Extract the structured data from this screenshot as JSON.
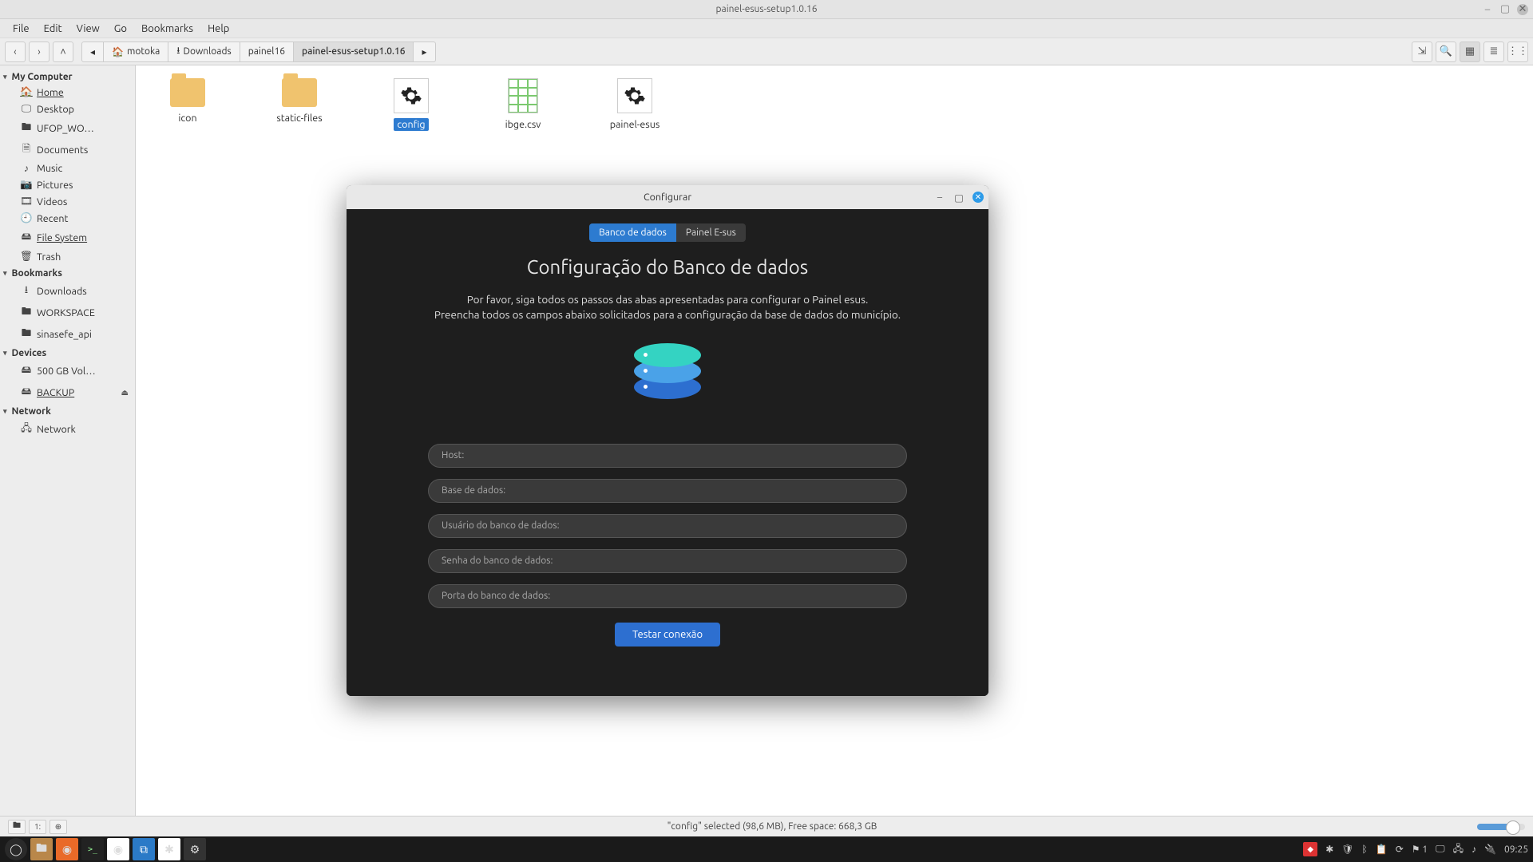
{
  "window": {
    "title": "painel-esus-setup1.0.16"
  },
  "menubar": [
    "File",
    "Edit",
    "View",
    "Go",
    "Bookmarks",
    "Help"
  ],
  "crumbs": [
    {
      "label": "motoka",
      "icon": "home"
    },
    {
      "label": "Downloads",
      "icon": "down"
    },
    {
      "label": "painel16"
    },
    {
      "label": "painel-esus-setup1.0.16",
      "active": true
    }
  ],
  "sidebar": {
    "my_computer": {
      "title": "My Computer",
      "items": [
        {
          "label": "Home",
          "icon": "home",
          "selected": true
        },
        {
          "label": "Desktop",
          "icon": "desktop"
        },
        {
          "label": "UFOP_WO…",
          "icon": "folder"
        },
        {
          "label": "Documents",
          "icon": "doc"
        },
        {
          "label": "Music",
          "icon": "music"
        },
        {
          "label": "Pictures",
          "icon": "pic"
        },
        {
          "label": "Videos",
          "icon": "vid"
        },
        {
          "label": "Recent",
          "icon": "clock"
        },
        {
          "label": "File System",
          "icon": "disk",
          "underline": true
        },
        {
          "label": "Trash",
          "icon": "trash"
        }
      ]
    },
    "bookmarks": {
      "title": "Bookmarks",
      "items": [
        {
          "label": "Downloads",
          "icon": "down"
        },
        {
          "label": "WORKSPACE",
          "icon": "folder"
        },
        {
          "label": "sinasefe_api",
          "icon": "folder"
        }
      ]
    },
    "devices": {
      "title": "Devices",
      "items": [
        {
          "label": "500 GB Vol…",
          "icon": "disk"
        },
        {
          "label": "BACKUP",
          "icon": "disk",
          "eject": true,
          "underline": true
        }
      ]
    },
    "network": {
      "title": "Network",
      "items": [
        {
          "label": "Network",
          "icon": "net"
        }
      ]
    }
  },
  "files": [
    {
      "name": "icon",
      "type": "folder"
    },
    {
      "name": "static-files",
      "type": "folder"
    },
    {
      "name": "config",
      "type": "exe",
      "selected": true
    },
    {
      "name": "ibge.csv",
      "type": "csv"
    },
    {
      "name": "painel-esus",
      "type": "exe"
    }
  ],
  "statusbar": {
    "text": "\"config\" selected (98,6 MB), Free space: 668,3 GB"
  },
  "dialog": {
    "title": "Configurar",
    "tabs": [
      {
        "label": "Banco de dados",
        "active": true
      },
      {
        "label": "Painel E-sus"
      }
    ],
    "heading": "Configuração do Banco de dados",
    "line1": "Por favor, siga todos os passos das abas apresentadas para configurar o Painel esus.",
    "line2": "Preencha todos os campos abaixo solicitados para a configuração da base de dados do município.",
    "fields": {
      "host": "Host:",
      "db": "Base de dados:",
      "user": "Usuário do banco de dados:",
      "pass": "Senha do banco de dados:",
      "port": "Porta do banco de dados:"
    },
    "button": "Testar conexão"
  },
  "taskbar": {
    "tray_badge": "1",
    "clock": "09:25"
  }
}
